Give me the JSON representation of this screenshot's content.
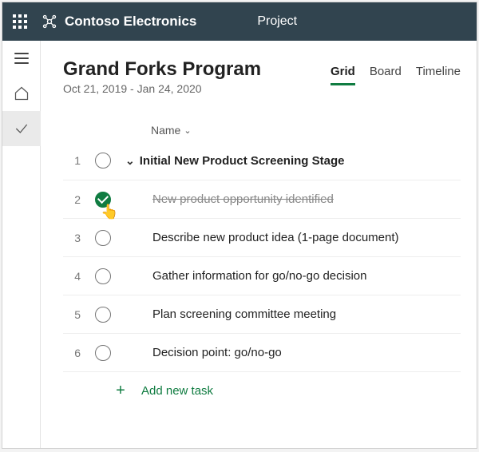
{
  "header": {
    "org_name": "Contoso Electronics",
    "app_name": "Project"
  },
  "project": {
    "title": "Grand Forks Program",
    "date_range": "Oct 21, 2019 - Jan 24, 2020"
  },
  "tabs": {
    "grid": "Grid",
    "board": "Board",
    "timeline": "Timeline"
  },
  "columns": {
    "name": "Name"
  },
  "tasks": [
    {
      "num": "1",
      "name": "Initial New Product Screening Stage",
      "parent": true,
      "done": false
    },
    {
      "num": "2",
      "name": "New product opportunity identified",
      "parent": false,
      "done": true
    },
    {
      "num": "3",
      "name": "Describe new product idea (1-page document)",
      "parent": false,
      "done": false
    },
    {
      "num": "4",
      "name": "Gather information for go/no-go decision",
      "parent": false,
      "done": false
    },
    {
      "num": "5",
      "name": "Plan screening committee meeting",
      "parent": false,
      "done": false
    },
    {
      "num": "6",
      "name": "Decision point: go/no-go",
      "parent": false,
      "done": false
    }
  ],
  "add_task_label": "Add new task"
}
